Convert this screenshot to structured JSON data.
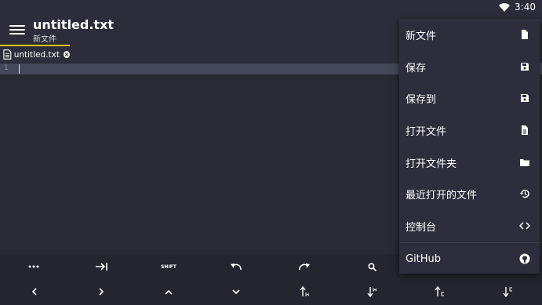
{
  "status": {
    "time": "3:40",
    "wifi_icon": "wifi-icon"
  },
  "toolbar": {
    "title": "untitled.txt",
    "subtitle": "新文件"
  },
  "tabs": [
    {
      "label": "untitled.txt",
      "icon": "file-text-icon",
      "close_icon": "close-circle-icon"
    }
  ],
  "editor": {
    "line_numbers": [
      "1"
    ]
  },
  "menu": {
    "items": [
      {
        "label": "新文件",
        "icon": "new-file-icon"
      },
      {
        "label": "保存",
        "icon": "save-icon"
      },
      {
        "label": "保存到",
        "icon": "save-as-icon"
      },
      {
        "label": "打开文件",
        "icon": "file-icon"
      },
      {
        "label": "打开文件夹",
        "icon": "folder-icon"
      },
      {
        "label": "最近打开的文件",
        "icon": "history-icon"
      },
      {
        "label": "控制台",
        "icon": "code-icon"
      },
      {
        "label": "GitHub",
        "icon": "github-icon"
      }
    ]
  },
  "keys": {
    "row1": [
      {
        "name": "more-key",
        "icon": "more-icon"
      },
      {
        "name": "tab-key",
        "icon": "tab-icon"
      },
      {
        "name": "shift-key",
        "label": "SHIFT"
      },
      {
        "name": "undo-key",
        "icon": "undo-icon"
      },
      {
        "name": "redo-key",
        "icon": "redo-icon"
      },
      {
        "name": "search-key",
        "icon": "search-icon"
      }
    ],
    "row2": [
      {
        "name": "left-key",
        "icon": "chevron-left-icon"
      },
      {
        "name": "right-key",
        "icon": "chevron-right-icon"
      },
      {
        "name": "up-key",
        "icon": "chevron-up-icon"
      },
      {
        "name": "down-key",
        "icon": "chevron-down-icon"
      },
      {
        "name": "move-line-up-key",
        "icon": "move-up-icon"
      },
      {
        "name": "move-line-down-key",
        "icon": "move-down-icon"
      },
      {
        "name": "copy-line-up-key",
        "icon": "copy-up-icon"
      },
      {
        "name": "copy-line-down-key",
        "icon": "copy-down-icon"
      }
    ]
  }
}
